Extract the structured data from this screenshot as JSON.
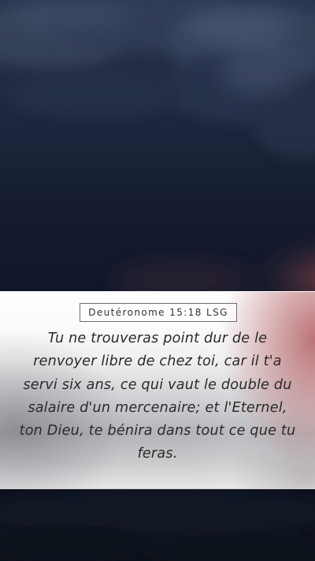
{
  "verse": {
    "reference": "Deutéronome 15:18 LSG",
    "text": "Tu ne trouveras point dur de le renvoyer libre de chez toi, car il t'a servi six ans, ce qui vaut le double du salaire d'un mercenaire; et l'Eternel, ton Dieu, te bénira dans tout ce que tu feras."
  },
  "colors": {
    "sky_top": "#2b3650",
    "sky_bottom": "#0b0f1a",
    "sunset_glow": "#a0504e",
    "text": "#2a2a2a",
    "reference_border": "#6f6f6f"
  }
}
